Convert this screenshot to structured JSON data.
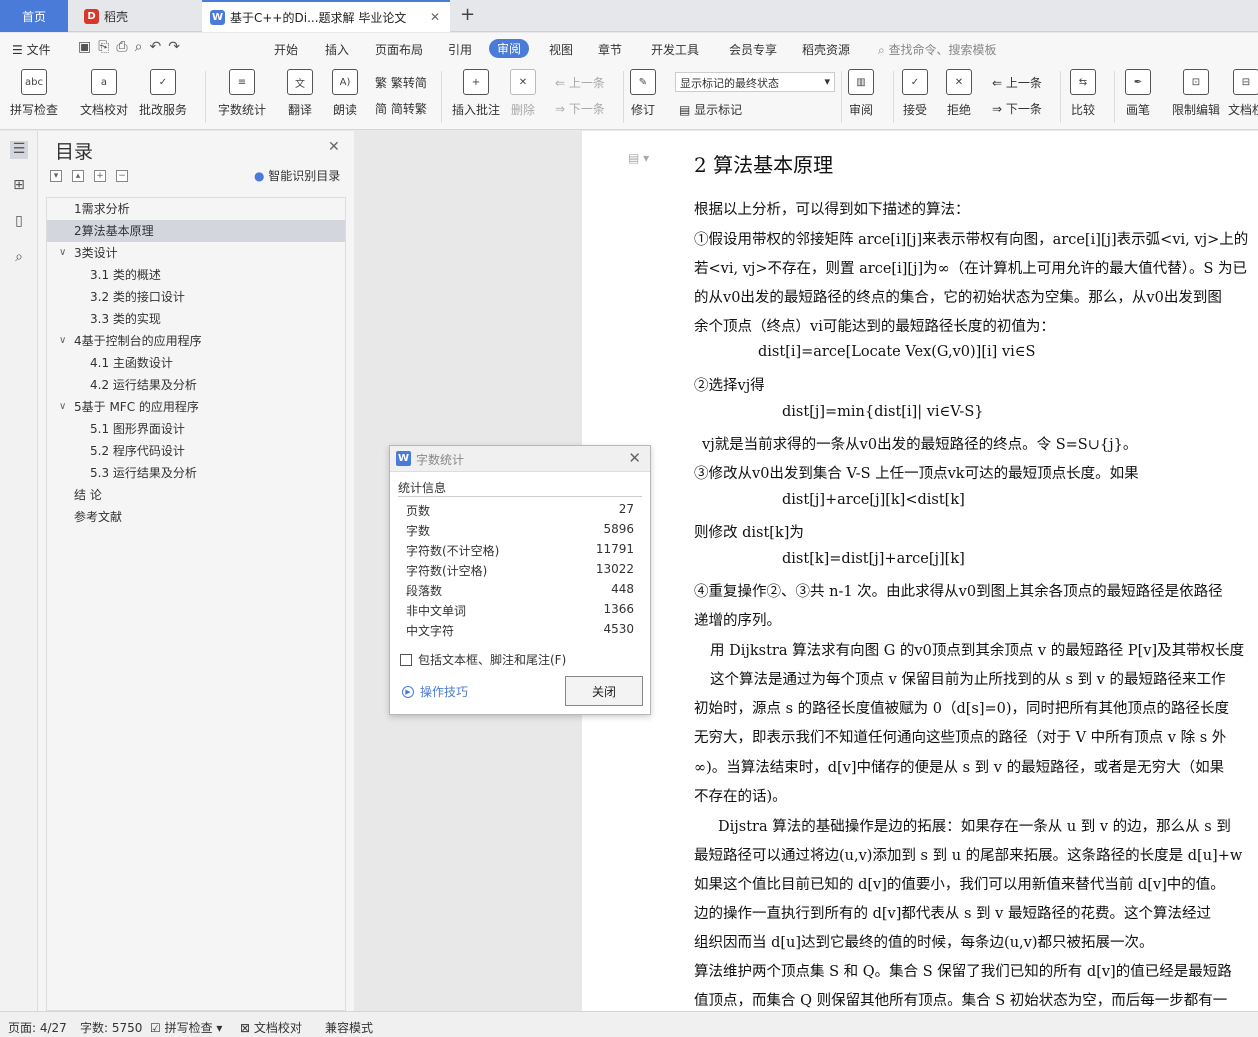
{
  "tabs": {
    "home": "首页",
    "daoke": "稻壳",
    "doc": "基于C++的Di...题求解 毕业论文"
  },
  "menu": {
    "file": "文件",
    "items": [
      "开始",
      "插入",
      "页面布局",
      "引用",
      "审阅",
      "视图",
      "章节",
      "开发工具",
      "会员专享",
      "稻壳资源"
    ],
    "search": "查找命令、搜索模板"
  },
  "ribbon": {
    "spell": "拼写检查",
    "proof": "文档校对",
    "revise_service": "批改服务",
    "word_count": "字数统计",
    "translate": "翻译",
    "read_aloud": "朗读",
    "to_trad": "繁转简",
    "to_simp": "简转繁",
    "insert_comment": "插入批注",
    "delete": "删除",
    "prev": "上一条",
    "next": "下一条",
    "track": "修订",
    "markup_option": "显示标记的最终状态",
    "show_markup": "显示标记",
    "review": "审阅",
    "accept": "接受",
    "reject": "拒绝",
    "prev2": "上一条",
    "next2": "下一条",
    "compare": "比较",
    "pen": "画笔",
    "restrict": "限制编辑",
    "doc_perm": "文档权"
  },
  "toc": {
    "title": "目录",
    "smart": "智能识别目录",
    "items": [
      {
        "t": "1需求分析",
        "lvl": 1
      },
      {
        "t": "2算法基本原理",
        "lvl": 1
      },
      {
        "t": "3类设计",
        "lvl": 1,
        "exp": true
      },
      {
        "t": "3.1  类的概述",
        "lvl": 2
      },
      {
        "t": "3.2  类的接口设计",
        "lvl": 2
      },
      {
        "t": "3.3  类的实现",
        "lvl": 2
      },
      {
        "t": "4基于控制台的应用程序",
        "lvl": 1,
        "exp": true
      },
      {
        "t": "4.1  主函数设计",
        "lvl": 2
      },
      {
        "t": "4.2  运行结果及分析",
        "lvl": 2
      },
      {
        "t": "5基于 MFC 的应用程序",
        "lvl": 1,
        "exp": true
      },
      {
        "t": "5.1  图形界面设计",
        "lvl": 2
      },
      {
        "t": "5.2  程序代码设计",
        "lvl": 2
      },
      {
        "t": "5.3  运行结果及分析",
        "lvl": 2
      },
      {
        "t": "结    论",
        "lvl": 1
      },
      {
        "t": "参考文献",
        "lvl": 1
      }
    ]
  },
  "doc": {
    "heading": "2  算法基本原理",
    "lines": [
      "根据以上分析，可以得到如下描述的算法：",
      "①假设用带权的邻接矩阵 arce[i][j]来表示带权有向图，arce[i][j]表示弧<vi, vj>上的",
      "若<vi, vj>不存在，则置 arce[i][j]为∞（在计算机上可用允许的最大值代替）。S 为已",
      "的从v0出发的最短路径的终点的集合，它的初始状态为空集。那么，从v0出发到图",
      "余个顶点（终点）vi可能达到的最短路径长度的初值为：",
      "dist[i]=arce[Locate Vex(G,v0)][i] vi∈S",
      "②选择vj得",
      "dist[j]=min{dist[i]| vi∈V-S}",
      "vj就是当前求得的一条从v0出发的最短路径的终点。令 S=S∪{j}。",
      "③修改从v0出发到集合 V-S 上任一顶点vk可达的最短顶点长度。如果",
      "dist[j]+arce[j][k]<dist[k]",
      "则修改 dist[k]为",
      "dist[k]=dist[j]+arce[j][k]",
      "④重复操作②、③共 n-1 次。由此求得从v0到图上其余各顶点的最短路径是依路径",
      "递增的序列。",
      "用 Dijkstra 算法求有向图 G 的v0顶点到其余顶点 v 的最短路径 P[v]及其带权长度",
      "这个算法是通过为每个顶点 v 保留目前为止所找到的从 s 到 v 的最短路径来工作",
      "初始时，源点 s 的路径长度值被赋为 0（d[s]=0)，同时把所有其他顶点的路径长度",
      "无穷大，即表示我们不知道任何通向这些顶点的路径（对于 V 中所有顶点 v 除 s 外",
      "∞)。当算法结束时，d[v]中储存的便是从 s 到 v 的最短路径，或者是无穷大（如果",
      "不存在的话)。",
      "Dijstra 算法的基础操作是边的拓展：如果存在一条从 u 到 v 的边，那么从 s 到",
      "最短路径可以通过将边(u,v)添加到 s 到 u 的尾部来拓展。这条路径的长度是 d[u]+w",
      "如果这个值比目前已知的 d[v]的值要小，我们可以用新值来替代当前 d[v]中的值。",
      "边的操作一直执行到所有的 d[v]都代表从 s 到 v 最短路径的花费。这个算法经过",
      "组织因而当 d[u]达到它最终的值的时候，每条边(u,v)都只被拓展一次。",
      "算法维护两个顶点集 S 和 Q。集合 S 保留了我们已知的所有 d[v]的值已经是最短路",
      "值顶点，而集合 Q 则保留其他所有顶点。集合 S 初始状态为空，而后每一步都有一"
    ]
  },
  "dialog": {
    "title": "字数统计",
    "section": "统计信息",
    "rows": [
      {
        "k": "页数",
        "v": "27"
      },
      {
        "k": "字数",
        "v": "5896"
      },
      {
        "k": "字符数(不计空格)",
        "v": "11791"
      },
      {
        "k": "字符数(计空格)",
        "v": "13022"
      },
      {
        "k": "段落数",
        "v": "448"
      },
      {
        "k": "非中文单词",
        "v": "1366"
      },
      {
        "k": "中文字符",
        "v": "4530"
      }
    ],
    "checkbox": "包括文本框、脚注和尾注(F)",
    "tips": "操作技巧",
    "close": "关闭"
  },
  "status": {
    "page": "页面: 4/27",
    "words": "字数: 5750",
    "spell": "拼写检查",
    "proof": "文档校对",
    "compat": "兼容模式"
  }
}
